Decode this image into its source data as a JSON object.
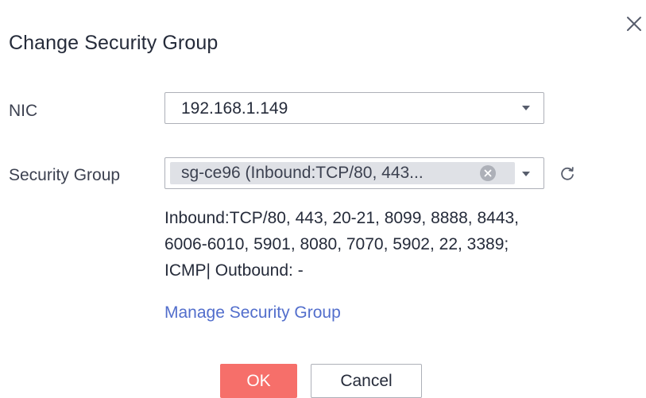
{
  "dialog": {
    "title": "Change Security Group"
  },
  "nic": {
    "label": "NIC",
    "value": "192.168.1.149"
  },
  "security_group": {
    "label": "Security Group",
    "selected_chip": "sg-ce96 (Inbound:TCP/80, 443...",
    "description_lines": [
      "Inbound:TCP/80, 443, 20-21, 8099, 8888, 8443,",
      "6006-6010, 5901, 8080, 7070, 5902, 22, 3389;",
      "ICMP| Outbound: -"
    ],
    "manage_link": "Manage Security Group"
  },
  "buttons": {
    "ok": "OK",
    "cancel": "Cancel"
  },
  "colors": {
    "primary_button": "#f66f6a",
    "link": "#526ecc",
    "chip_bg": "#dfe1e6",
    "border": "#adb0b8"
  },
  "icons": {
    "close": "close-icon",
    "dropdown": "chevron-down-icon",
    "clear": "clear-icon",
    "refresh": "refresh-icon"
  }
}
